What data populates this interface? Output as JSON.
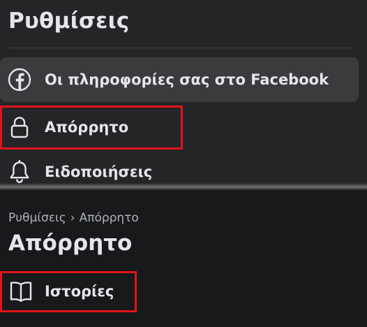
{
  "settings": {
    "title": "Ρυθμίσεις",
    "items": [
      {
        "label": "Οι πληροφορίες σας στο Facebook",
        "icon": "facebook-icon"
      },
      {
        "label": "Απόρρητο",
        "icon": "lock-icon"
      },
      {
        "label": "Ειδοποιήσεις",
        "icon": "bell-icon"
      }
    ]
  },
  "privacy": {
    "breadcrumb": [
      "Ρυθμίσεις",
      "Απόρρητο"
    ],
    "breadcrumb_separator": "›",
    "title": "Απόρρητο",
    "items": [
      {
        "label": "Ιστορίες",
        "icon": "book-icon"
      }
    ]
  },
  "colors": {
    "highlight": "#e0141b",
    "background": "#242526",
    "text": "#e4e6eb"
  }
}
